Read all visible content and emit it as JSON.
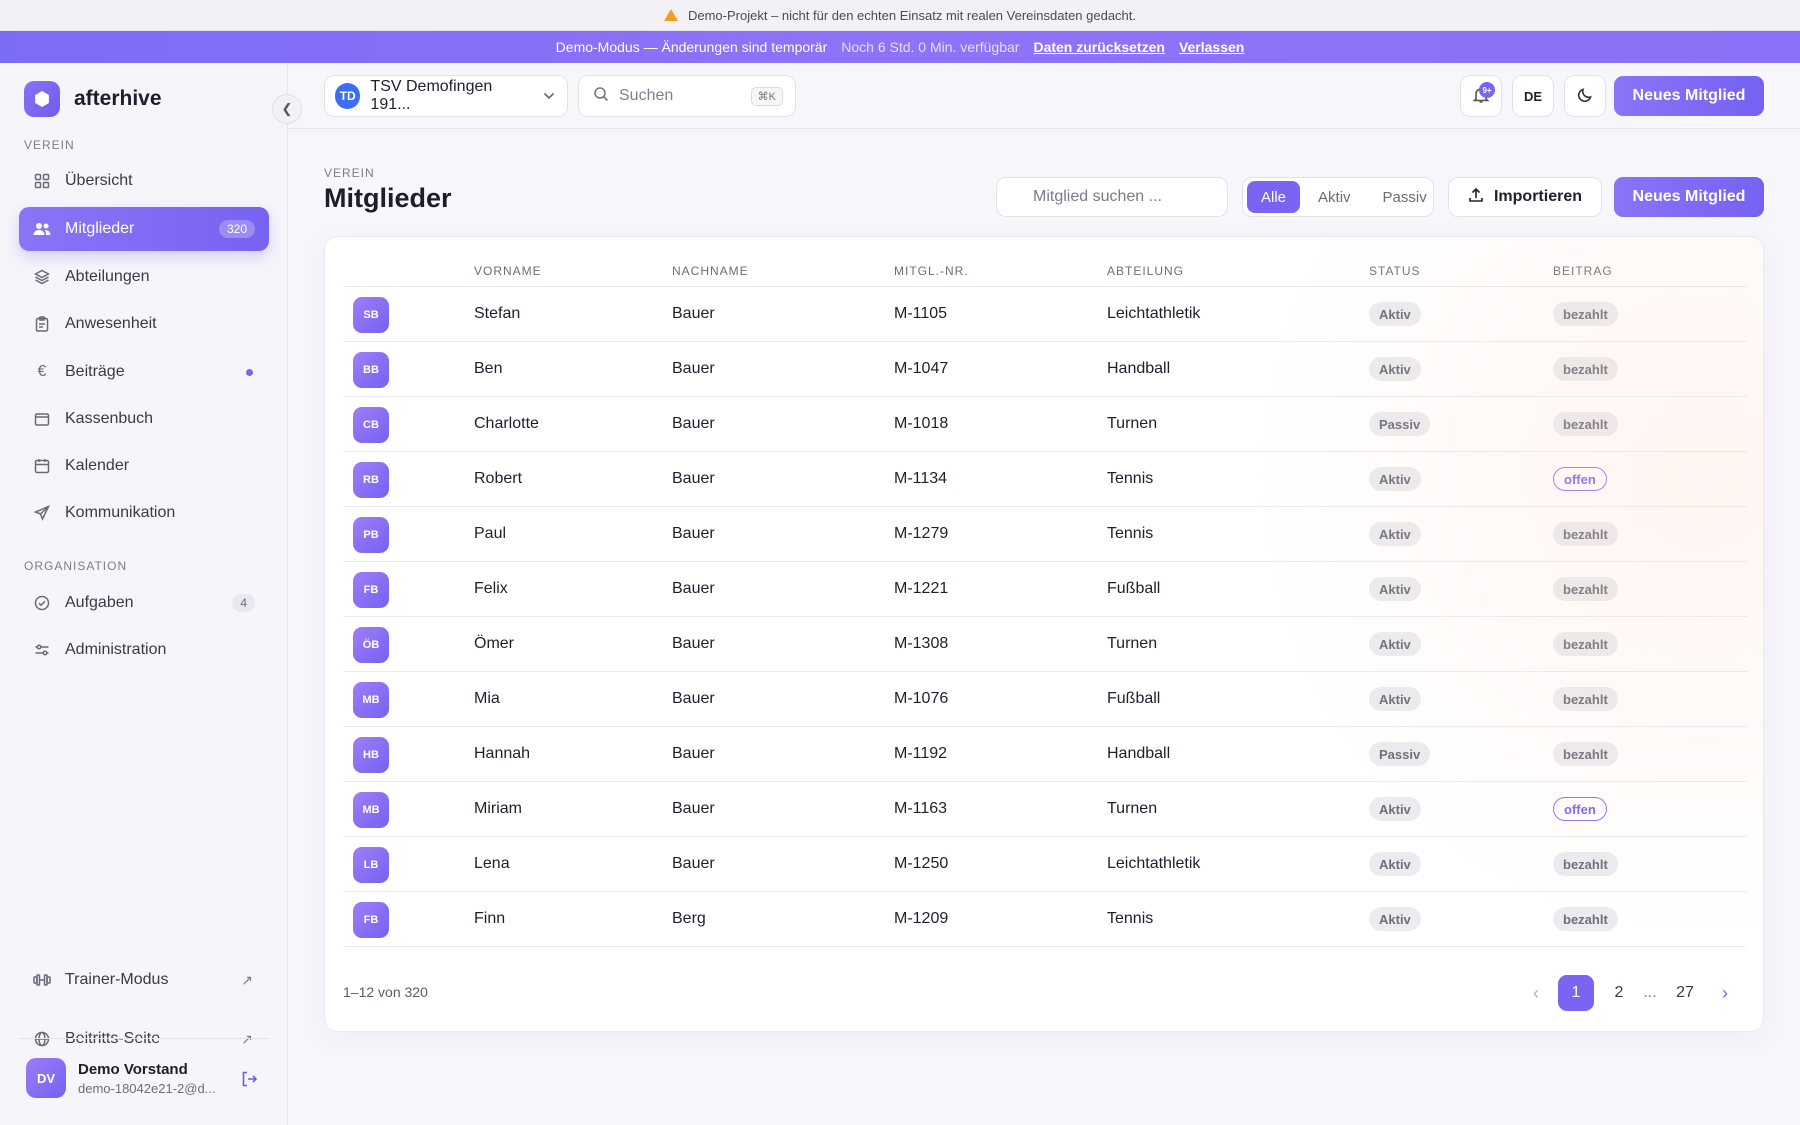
{
  "banner": {
    "warning": "Demo-Projekt – nicht für den echten Einsatz mit realen Vereinsdaten gedacht.",
    "demo_mode": "Demo-Modus — Änderungen sind temporär",
    "time_left": "Noch 6 Std. 0 Min. verfügbar",
    "reset_link": "Daten zurücksetzen",
    "leave_link": "Verlassen"
  },
  "brand": {
    "name": "afterhive"
  },
  "sidebar": {
    "section_verein": "VEREIN",
    "section_org": "ORGANISATION",
    "items": [
      {
        "label": "Übersicht",
        "icon": "grid-icon"
      },
      {
        "label": "Mitglieder",
        "icon": "users-icon",
        "count": "320"
      },
      {
        "label": "Abteilungen",
        "icon": "layers-icon"
      },
      {
        "label": "Anwesenheit",
        "icon": "clipboard-icon"
      },
      {
        "label": "Beiträge",
        "icon": "euro-icon"
      },
      {
        "label": "Kassenbuch",
        "icon": "wallet-icon"
      },
      {
        "label": "Kalender",
        "icon": "calendar-icon"
      },
      {
        "label": "Kommunikation",
        "icon": "send-icon"
      }
    ],
    "org_items": [
      {
        "label": "Aufgaben",
        "icon": "check-circle-icon",
        "count": "4"
      },
      {
        "label": "Administration",
        "icon": "sliders-icon"
      }
    ],
    "bottom_items": [
      {
        "label": "Trainer-Modus",
        "icon": "dumbbell-icon"
      },
      {
        "label": "Beitritts-Seite",
        "icon": "globe-icon"
      }
    ],
    "user": {
      "initials": "DV",
      "name": "Demo Vorstand",
      "email": "demo-18042e21-2@d..."
    }
  },
  "topbar": {
    "club_initials": "TD",
    "club_name": "TSV Demofingen 191...",
    "search_placeholder": "Suchen",
    "search_shortcut": "⌘K",
    "notif_badge": "9+",
    "lang": "DE",
    "new_member": "Neues Mitglied"
  },
  "page": {
    "eyebrow": "VEREIN",
    "title": "Mitglieder",
    "member_search_placeholder": "Mitglied suchen ...",
    "filters": [
      "Alle",
      "Aktiv",
      "Passiv"
    ],
    "import": "Importieren",
    "new_member": "Neues Mitglied"
  },
  "table": {
    "headers": [
      "VORNAME",
      "NACHNAME",
      "MITGL.-NR.",
      "ABTEILUNG",
      "STATUS",
      "BEITRAG"
    ],
    "rows": [
      {
        "initials": "SB",
        "first": "Stefan",
        "last": "Bauer",
        "nr": "M-1105",
        "dept": "Leichtathletik",
        "status": "Aktiv",
        "fee": "bezahlt"
      },
      {
        "initials": "BB",
        "first": "Ben",
        "last": "Bauer",
        "nr": "M-1047",
        "dept": "Handball",
        "status": "Aktiv",
        "fee": "bezahlt"
      },
      {
        "initials": "CB",
        "first": "Charlotte",
        "last": "Bauer",
        "nr": "M-1018",
        "dept": "Turnen",
        "status": "Passiv",
        "fee": "bezahlt"
      },
      {
        "initials": "RB",
        "first": "Robert",
        "last": "Bauer",
        "nr": "M-1134",
        "dept": "Tennis",
        "status": "Aktiv",
        "fee": "offen"
      },
      {
        "initials": "PB",
        "first": "Paul",
        "last": "Bauer",
        "nr": "M-1279",
        "dept": "Tennis",
        "status": "Aktiv",
        "fee": "bezahlt"
      },
      {
        "initials": "FB",
        "first": "Felix",
        "last": "Bauer",
        "nr": "M-1221",
        "dept": "Fußball",
        "status": "Aktiv",
        "fee": "bezahlt"
      },
      {
        "initials": "ÖB",
        "first": "Ömer",
        "last": "Bauer",
        "nr": "M-1308",
        "dept": "Turnen",
        "status": "Aktiv",
        "fee": "bezahlt"
      },
      {
        "initials": "MB",
        "first": "Mia",
        "last": "Bauer",
        "nr": "M-1076",
        "dept": "Fußball",
        "status": "Aktiv",
        "fee": "bezahlt"
      },
      {
        "initials": "HB",
        "first": "Hannah",
        "last": "Bauer",
        "nr": "M-1192",
        "dept": "Handball",
        "status": "Passiv",
        "fee": "bezahlt"
      },
      {
        "initials": "MB",
        "first": "Miriam",
        "last": "Bauer",
        "nr": "M-1163",
        "dept": "Turnen",
        "status": "Aktiv",
        "fee": "offen"
      },
      {
        "initials": "LB",
        "first": "Lena",
        "last": "Bauer",
        "nr": "M-1250",
        "dept": "Leichtathletik",
        "status": "Aktiv",
        "fee": "bezahlt"
      },
      {
        "initials": "FB",
        "first": "Finn",
        "last": "Berg",
        "nr": "M-1209",
        "dept": "Tennis",
        "status": "Aktiv",
        "fee": "bezahlt"
      }
    ],
    "range": "1–12 von 320",
    "pages": [
      "1",
      "2",
      "...",
      "27"
    ]
  },
  "colors": {
    "accent": "#7a64f3",
    "banner": "#8b6ff6"
  }
}
